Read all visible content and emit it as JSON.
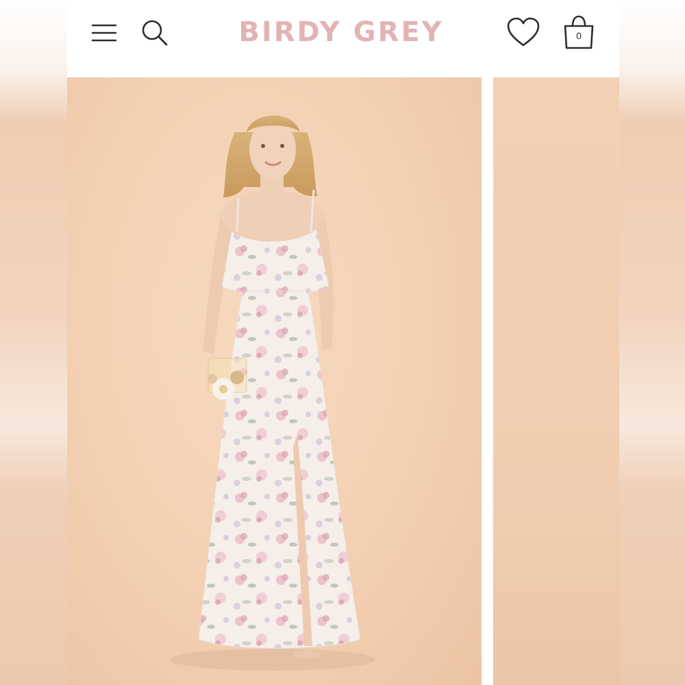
{
  "header": {
    "brand": "BIRDY GREY",
    "bag_count": "0",
    "icons": {
      "menu": "hamburger-menu-icon",
      "search": "search-icon",
      "wishlist": "heart-icon",
      "bag": "shopping-bag-icon"
    }
  },
  "gallery": {
    "slides": [
      "product-photo-main",
      "product-photo-next"
    ]
  },
  "colors": {
    "brand_pink": "#e3b3b3",
    "backdrop_peach": "#f3d0b2",
    "icon_dark": "#2c2c2c"
  }
}
